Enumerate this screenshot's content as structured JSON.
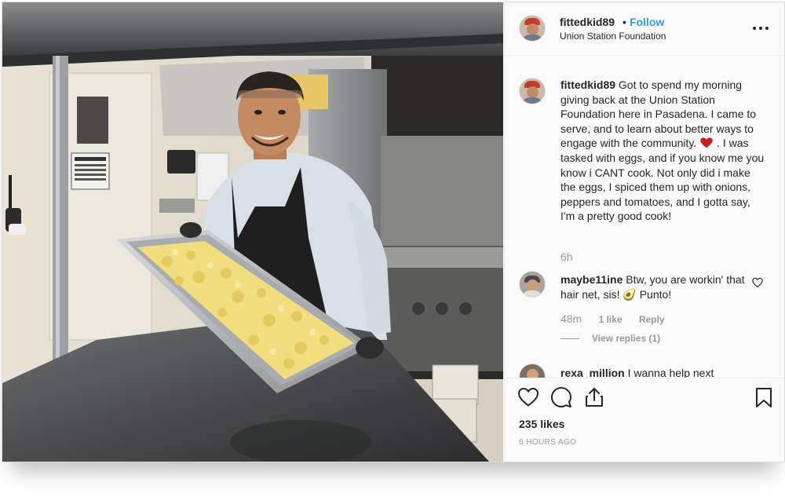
{
  "post": {
    "header": {
      "username": "fittedkid89",
      "separator": "•",
      "follow_label": "Follow",
      "location": "Union Station Foundation"
    },
    "caption": {
      "username": "fittedkid89",
      "text_part1": "Got to spend my morning giving back at the Union Station Foundation here in Pasadena. I came to serve, and to learn about better ways to engage with the community.",
      "text_part2": ". I was tasked with eggs, and if you know me you know i CANT cook. Not only did i make the eggs, I spiced them up with onions, peppers and tomatoes, and I gotta say, I'm a pretty good cook!",
      "time": "6h"
    },
    "comments": [
      {
        "username": "maybe11ine",
        "text": "Btw, you are workin' that hair net, sis!",
        "emoji": "🥑",
        "text_end": "Punto!",
        "time": "48m",
        "likes_label": "1 like",
        "reply_label": "Reply",
        "view_replies": "View replies (1)"
      },
      {
        "username": "rexa_million",
        "text": "I wanna help next"
      }
    ],
    "likes": "235 likes",
    "time_ago": "6 HOURS AGO",
    "colors": {
      "follow": "#3897f0",
      "heart": "#ed4956",
      "muted": "#999999",
      "text": "#262626"
    },
    "icons": [
      "heart-icon",
      "comment-icon",
      "share-icon",
      "bookmark-icon",
      "more-options-icon"
    ]
  }
}
